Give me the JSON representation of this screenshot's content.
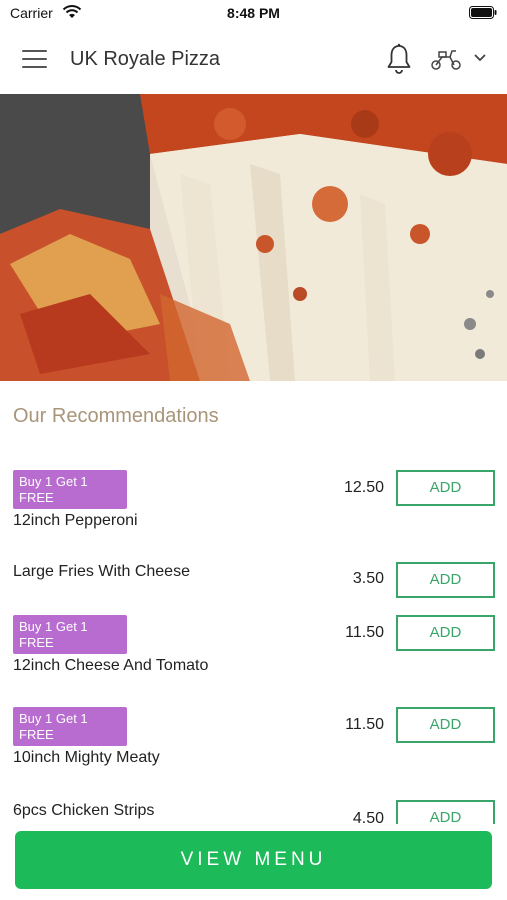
{
  "status": {
    "carrier": "Carrier",
    "time": "8:48 PM"
  },
  "header": {
    "title": "UK Royale Pizza"
  },
  "section": {
    "title": "Our Recommendations"
  },
  "items": [
    {
      "badge": "Buy 1 Get 1 FREE",
      "name": "12inch Pepperoni",
      "price": "12.50",
      "button": "ADD"
    },
    {
      "badge": "",
      "name": "Large Fries With Cheese",
      "price": "3.50",
      "button": "ADD"
    },
    {
      "badge": "Buy 1 Get 1 FREE",
      "name": "12inch Cheese And Tomato",
      "price": "11.50",
      "button": "ADD"
    },
    {
      "badge": "Buy 1 Get 1 FREE",
      "name": "10inch Mighty Meaty",
      "price": "11.50",
      "button": "ADD"
    },
    {
      "badge": "",
      "name": "6pcs Chicken Strips",
      "price": "4.50",
      "button": "ADD"
    }
  ],
  "footer": {
    "view_menu": "VIEW MENU"
  },
  "colors": {
    "badge": "#b86ccf",
    "add_button": "#3aa56a",
    "view_menu": "#1cba58",
    "section_title": "#a8957a"
  }
}
